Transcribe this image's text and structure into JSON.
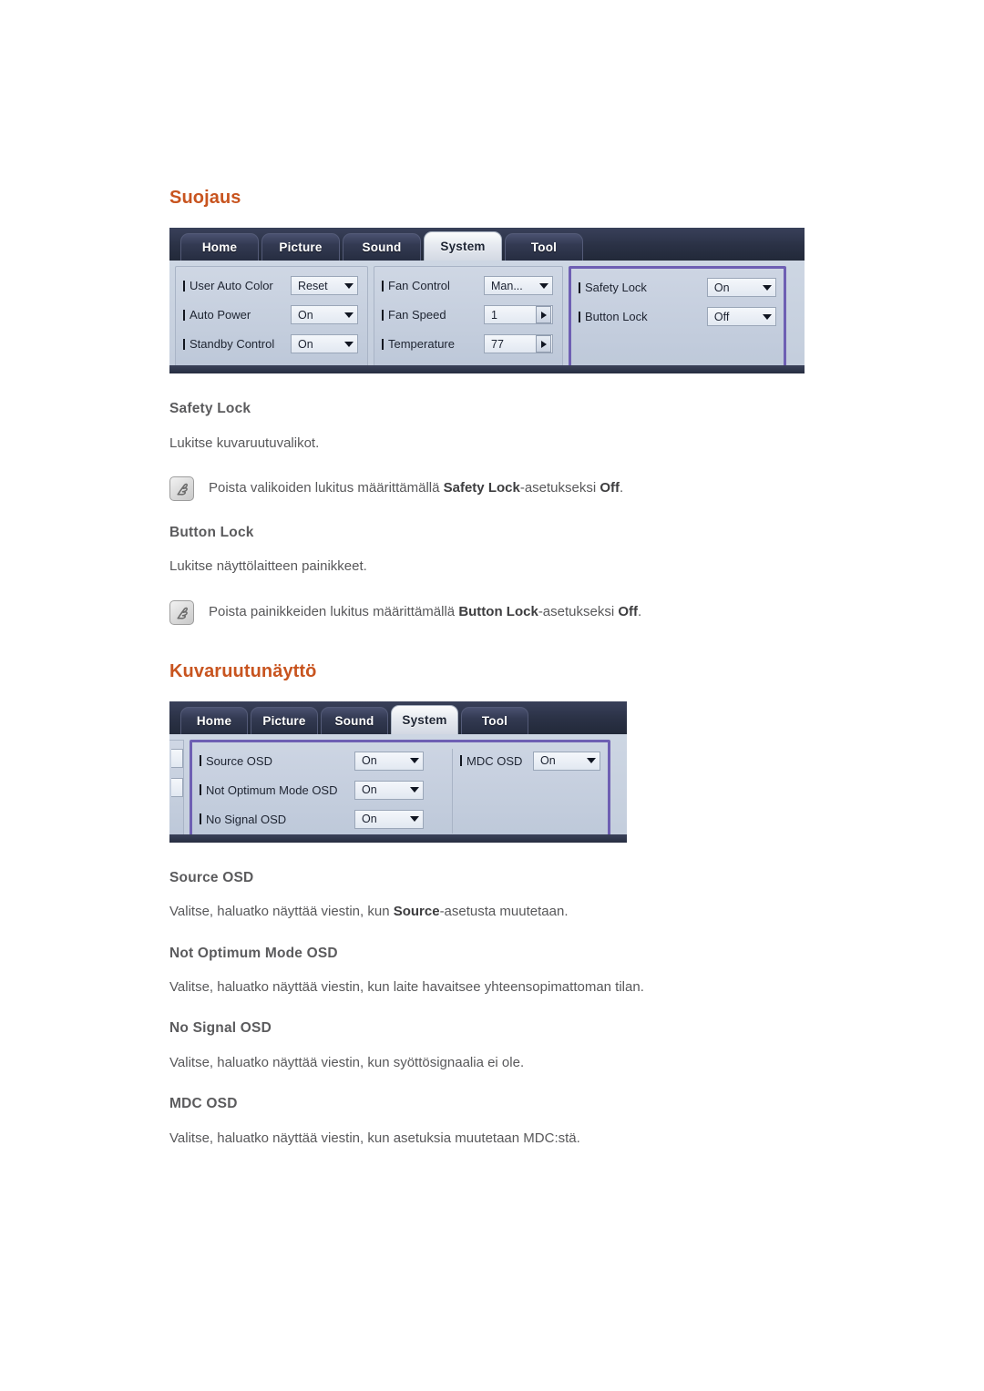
{
  "page": {
    "section1_title": "Suojaus",
    "section2_title": "Kuvaruutunäyttö"
  },
  "mdc_security": {
    "tabs": [
      {
        "label": "Home",
        "active": false
      },
      {
        "label": "Picture",
        "active": false
      },
      {
        "label": "Sound",
        "active": false
      },
      {
        "label": "System",
        "active": true
      },
      {
        "label": "Tool",
        "active": false
      }
    ],
    "group1": [
      {
        "label": "User Auto Color",
        "value": "Reset",
        "control": "dropdown"
      },
      {
        "label": "Auto Power",
        "value": "On",
        "control": "dropdown"
      },
      {
        "label": "Standby Control",
        "value": "On",
        "control": "dropdown"
      }
    ],
    "group2": [
      {
        "label": "Fan Control",
        "value": "Man...",
        "control": "dropdown"
      },
      {
        "label": "Fan Speed",
        "value": "1",
        "control": "spinner"
      },
      {
        "label": "Temperature",
        "value": "77",
        "control": "spinner"
      }
    ],
    "group3": [
      {
        "label": "Safety Lock",
        "value": "On",
        "control": "dropdown"
      },
      {
        "label": "Button Lock",
        "value": "Off",
        "control": "dropdown"
      }
    ],
    "highlight_color": "#6e5fb3"
  },
  "mdc_osd": {
    "tabs": [
      {
        "label": "Home",
        "active": false
      },
      {
        "label": "Picture",
        "active": false
      },
      {
        "label": "Sound",
        "active": false
      },
      {
        "label": "System",
        "active": true
      },
      {
        "label": "Tool",
        "active": false
      }
    ],
    "group1": [
      {
        "label": "Source OSD",
        "value": "On",
        "control": "dropdown"
      },
      {
        "label": "Not Optimum Mode OSD",
        "value": "On",
        "control": "dropdown"
      },
      {
        "label": "No Signal OSD",
        "value": "On",
        "control": "dropdown"
      }
    ],
    "group2": [
      {
        "label": "MDC OSD",
        "value": "On",
        "control": "dropdown"
      }
    ],
    "highlight_color": "#6e5fb3"
  },
  "topics": {
    "safety_lock": {
      "title": "Safety Lock",
      "body": "Lukitse kuvaruutuvalikot.",
      "note_prefix": "Poista valikoiden lukitus määrittämällä ",
      "note_bold1": "Safety Lock",
      "note_mid": "-asetukseksi ",
      "note_bold2": "Off",
      "note_suffix": "."
    },
    "button_lock": {
      "title": "Button Lock",
      "body": "Lukitse näyttölaitteen painikkeet.",
      "note_prefix": "Poista painikkeiden lukitus määrittämällä ",
      "note_bold1": "Button Lock",
      "note_mid": "-asetukseksi ",
      "note_bold2": "Off",
      "note_suffix": "."
    },
    "source_osd": {
      "title": "Source OSD",
      "body_prefix": "Valitse, haluatko näyttää viestin, kun ",
      "body_bold": "Source",
      "body_suffix": "-asetusta muutetaan."
    },
    "not_optimum_mode_osd": {
      "title": "Not Optimum Mode OSD",
      "body": "Valitse, haluatko näyttää viestin, kun laite havaitsee yhteensopimattoman tilan."
    },
    "no_signal_osd": {
      "title": "No Signal OSD",
      "body": "Valitse, haluatko näyttää viestin, kun syöttösignaalia ei ole."
    },
    "mdc_osd": {
      "title": "MDC OSD",
      "body": "Valitse, haluatko näyttää viestin, kun asetuksia muutetaan MDC:stä."
    }
  },
  "colors": {
    "heading_orange": "#c8541f",
    "subheading_gray": "#5b5b5d",
    "body_gray": "#58585a",
    "mdc_chrome": "#2b3246",
    "mdc_panel": "#c6d0de",
    "highlight_purple": "#6e5fb3"
  }
}
